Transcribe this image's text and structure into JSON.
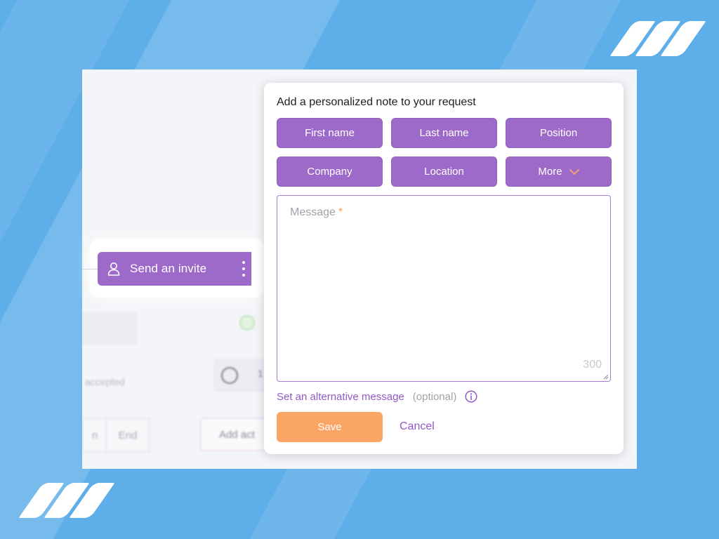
{
  "popup": {
    "title": "Add a personalized note to your request",
    "tags": [
      "First name",
      "Last name",
      "Position",
      "Company",
      "Location"
    ],
    "more_label": "More",
    "message": {
      "placeholder": "Message",
      "required_mark": "*",
      "value": "",
      "char_limit": "300"
    },
    "alternative_link": "Set an alternative message",
    "optional_label": "(optional)",
    "save_label": "Save",
    "cancel_label": "Cancel"
  },
  "invite_node": {
    "label": "Send an invite"
  },
  "background_ui": {
    "end_label": "End",
    "add_action_label": "Add act",
    "accepted_text": "accepted",
    "partial_left": "n",
    "partial_right": "1"
  },
  "colors": {
    "background": "#5eaeea",
    "accent_purple": "#9d6ac9",
    "save_orange": "#fba565",
    "link_purple": "#9159c4"
  }
}
